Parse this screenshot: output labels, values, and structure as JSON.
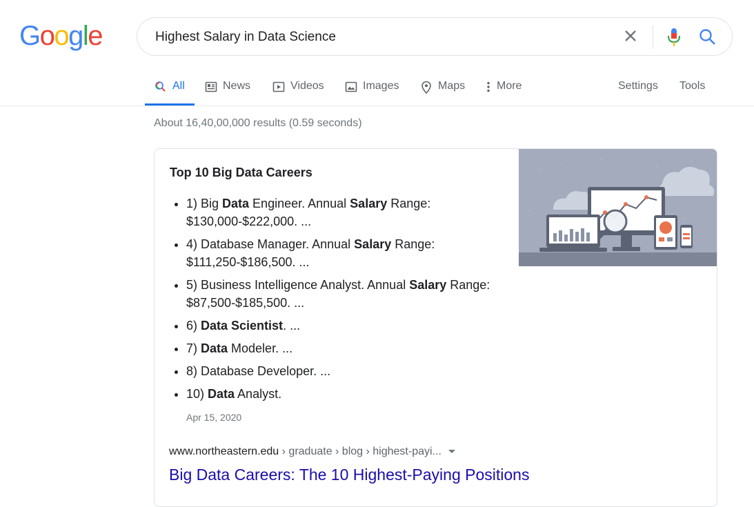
{
  "logo": {
    "letters": [
      "G",
      "o",
      "o",
      "g",
      "l",
      "e"
    ],
    "colors": [
      "#4285f4",
      "#ea4335",
      "#fbbc05",
      "#4285f4",
      "#34a853",
      "#ea4335"
    ]
  },
  "search": {
    "query": "Highest Salary in Data Science"
  },
  "tabs": [
    {
      "label": "All",
      "icon": "search-icon",
      "active": true
    },
    {
      "label": "News",
      "icon": "news-icon"
    },
    {
      "label": "Videos",
      "icon": "video-icon"
    },
    {
      "label": "Images",
      "icon": "image-icon"
    },
    {
      "label": "Maps",
      "icon": "map-pin-icon"
    },
    {
      "label": "More",
      "icon": "more-vertical-icon"
    }
  ],
  "toolbar": {
    "settings_label": "Settings",
    "tools_label": "Tools"
  },
  "result_stats": "About 16,40,00,000 results (0.59 seconds)",
  "featured_snippet": {
    "title": "Top 10 Big Data Careers",
    "items": [
      {
        "parts": [
          {
            "t": "1) Big "
          },
          {
            "t": "Data",
            "b": true
          },
          {
            "t": " Engineer. Annual "
          },
          {
            "t": "Salary",
            "b": true
          },
          {
            "t": " Range: $130,000-$222,000. ..."
          }
        ]
      },
      {
        "parts": [
          {
            "t": "4) Database Manager. Annual "
          },
          {
            "t": "Salary",
            "b": true
          },
          {
            "t": " Range: $111,250-$186,500. ..."
          }
        ]
      },
      {
        "parts": [
          {
            "t": "5) Business Intelligence Analyst. Annual "
          },
          {
            "t": "Salary",
            "b": true
          },
          {
            "t": " Range: $87,500-$185,500. ..."
          }
        ]
      },
      {
        "parts": [
          {
            "t": "6) "
          },
          {
            "t": "Data Scientist",
            "b": true
          },
          {
            "t": ". ..."
          }
        ]
      },
      {
        "parts": [
          {
            "t": "7) "
          },
          {
            "t": "Data",
            "b": true
          },
          {
            "t": " Modeler. ..."
          }
        ]
      },
      {
        "parts": [
          {
            "t": "8) Database Developer. ..."
          }
        ]
      },
      {
        "parts": [
          {
            "t": "10) "
          },
          {
            "t": "Data",
            "b": true
          },
          {
            "t": " Analyst."
          }
        ]
      }
    ],
    "date": "Apr 15, 2020",
    "url": {
      "domain": "www.northeastern.edu",
      "path": " › graduate › blog › highest-payi..."
    },
    "link_title": "Big Data Careers: The 10 Highest-Paying Positions"
  }
}
